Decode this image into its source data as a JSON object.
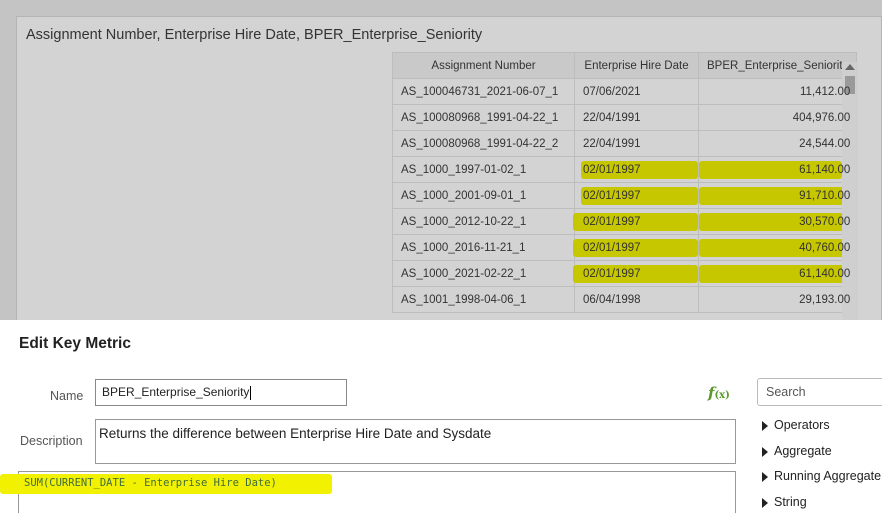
{
  "report": {
    "title": "Assignment Number, Enterprise Hire Date, BPER_Enterprise_Seniority",
    "columns": [
      "Assignment Number",
      "Enterprise Hire Date",
      "BPER_Enterprise_Seniority"
    ],
    "rows": [
      [
        "AS_100046731_2021-06-07_1",
        "07/06/2021",
        "11,412.00"
      ],
      [
        "AS_100080968_1991-04-22_1",
        "22/04/1991",
        "404,976.00"
      ],
      [
        "AS_100080968_1991-04-22_2",
        "22/04/1991",
        "24,544.00"
      ],
      [
        "AS_1000_1997-01-02_1",
        "02/01/1997",
        "61,140.00"
      ],
      [
        "AS_1000_2001-09-01_1",
        "02/01/1997",
        "91,710.00"
      ],
      [
        "AS_1000_2012-10-22_1",
        "02/01/1997",
        "30,570.00"
      ],
      [
        "AS_1000_2016-11-21_1",
        "02/01/1997",
        "40,760.00"
      ],
      [
        "AS_1000_2021-02-22_1",
        "02/01/1997",
        "61,140.00"
      ],
      [
        "AS_1001_1998-04-06_1",
        "06/04/1998",
        "29,193.00"
      ]
    ],
    "highlight_color": "#c7c700"
  },
  "dialog": {
    "title": "Edit Key Metric",
    "name_label": "Name",
    "name_value": "BPER_Enterprise_Seniority",
    "description_label": "Description",
    "description_value": "Returns the difference between Enterprise Hire Date and Sysdate",
    "expression": "SUM(CURRENT_DATE - Enterprise Hire Date)",
    "fx_icon": "f",
    "fx_sub": "(x)",
    "search_placeholder": "Search",
    "function_groups": [
      "Operators",
      "Aggregate",
      "Running Aggregate",
      "String"
    ],
    "expression_highlight_color": "#f2f200"
  }
}
